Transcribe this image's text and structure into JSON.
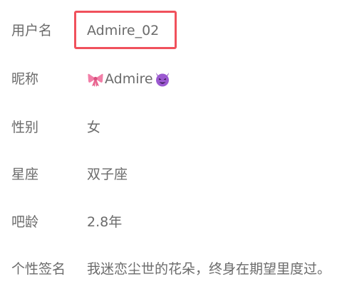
{
  "profile": {
    "username": {
      "label": "用户名",
      "value": "Admire_02"
    },
    "nickname": {
      "label": "昵称",
      "value": "Admire",
      "prefix_icon": "ribbon-icon",
      "suffix_icon": "smiling-devil-icon"
    },
    "gender": {
      "label": "性别",
      "value": "女"
    },
    "zodiac": {
      "label": "星座",
      "value": "双子座"
    },
    "account_age": {
      "label": "吧龄",
      "value": "2.8年"
    },
    "signature": {
      "label": "个性签名",
      "value": "我迷恋尘世的花朵，终身在期望里度过。"
    }
  },
  "colors": {
    "highlight_border": "#f0515c",
    "text": "#6b6b6b"
  }
}
